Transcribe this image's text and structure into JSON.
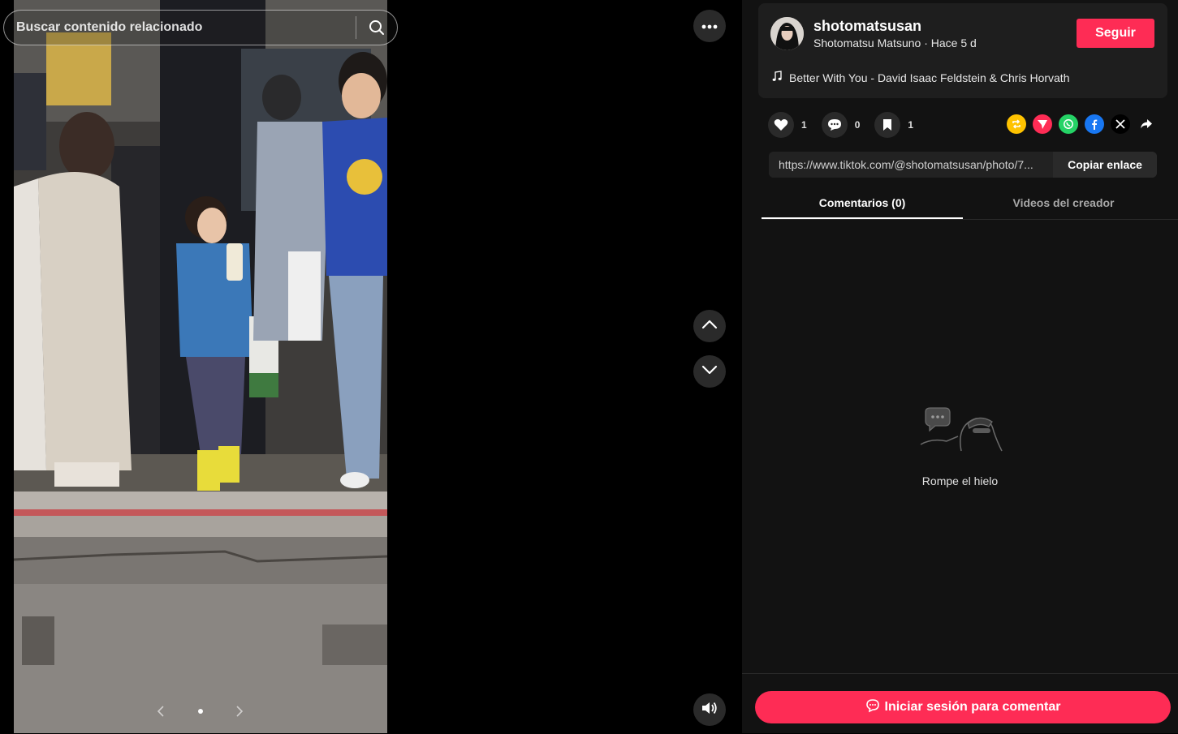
{
  "search": {
    "placeholder": "Buscar contenido relacionado"
  },
  "author": {
    "username": "shotomatsusan",
    "display_name": "Shotomatsu Matsuno",
    "time_ago": "Hace 5 d",
    "follow_label": "Seguir"
  },
  "music": {
    "icon": "music-note-icon",
    "title": "Better With You - David Isaac Feldstein & Chris Horvath"
  },
  "actions": {
    "likes": "1",
    "comments": "0",
    "saves": "1"
  },
  "share": {
    "icons": [
      "repost-icon",
      "send-icon",
      "whatsapp-icon",
      "facebook-icon",
      "x-icon",
      "share-arrow-icon"
    ],
    "colors": {
      "repost": "#ffc300",
      "send": "#fe2c55",
      "whatsapp": "#25d366",
      "facebook": "#1877f2",
      "x": "#000000"
    }
  },
  "link": {
    "url": "https://www.tiktok.com/@shotomatsusan/photo/7...",
    "copy_label": "Copiar enlace"
  },
  "tabs": {
    "comments": "Comentarios (0)",
    "videos": "Videos del creador"
  },
  "empty_state": {
    "text": "Rompe el hielo"
  },
  "login": {
    "label": "Iniciar sesión para comentar"
  },
  "theme": {
    "accent": "#fe2c55",
    "panel_bg": "#121212",
    "card_bg": "#1e1e1e"
  }
}
